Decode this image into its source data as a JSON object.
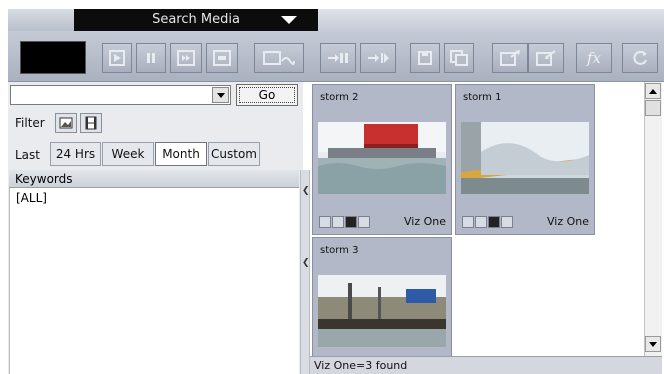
{
  "header": {
    "title": "Search Media",
    "dropdown_icon": "caret-down-icon"
  },
  "toolbar": {
    "buttons": [
      {
        "name": "play-icon"
      },
      {
        "name": "pause-icon"
      },
      {
        "name": "step-forward-icon"
      },
      {
        "name": "end-icon"
      },
      {
        "name": "link-clip-icon"
      },
      {
        "name": "insert-icon"
      },
      {
        "name": "append-icon"
      },
      {
        "name": "save-icon"
      },
      {
        "name": "save-all-icon"
      },
      {
        "name": "import-icon"
      },
      {
        "name": "export-icon"
      },
      {
        "name": "function-icon",
        "glyph": "fx"
      },
      {
        "name": "refresh-icon"
      }
    ]
  },
  "search": {
    "query": "",
    "go_label": "Go"
  },
  "filter": {
    "label": "Filter",
    "types": [
      "image-filter-icon",
      "video-filter-icon"
    ]
  },
  "date_range": {
    "label": "Last",
    "options": [
      "24 Hrs",
      "Week",
      "Month",
      "Custom"
    ],
    "selected": "Month"
  },
  "keywords": {
    "header": "Keywords",
    "items": [
      "[ALL]"
    ]
  },
  "results": {
    "items": [
      {
        "title": "storm 2",
        "source": "Viz One"
      },
      {
        "title": "storm 1",
        "source": "Viz One"
      },
      {
        "title": "storm 3",
        "source": ""
      }
    ],
    "status": "Viz One=3 found"
  },
  "colors": {
    "title_bg": "#0c0c0c",
    "toolbar_bg": "#b8bfcb",
    "card_bg": "#b2b8c8",
    "card_border": "#8a90a0"
  }
}
